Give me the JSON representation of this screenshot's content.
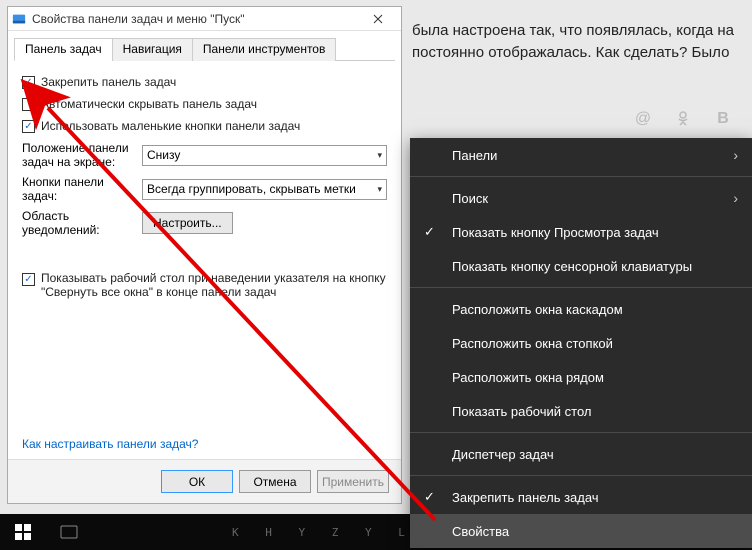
{
  "background_text": "была настроена так, что появлялась, когда на постоянно отображалась. Как сделать? Было",
  "social_icons": [
    "@",
    "ok",
    "B"
  ],
  "dialog": {
    "title": "Свойства панели задач и меню \"Пуск\"",
    "tabs": [
      "Панель задач",
      "Навигация",
      "Панели инструментов"
    ],
    "active_tab": 0,
    "chk_lock": "Закрепить панель задач",
    "chk_autohide": "Автоматически скрывать панель задач",
    "chk_small": "Использовать маленькие кнопки панели задач",
    "label_position": "Положение панели задач на экране:",
    "select_position": "Снизу",
    "label_buttons": "Кнопки панели задач:",
    "select_buttons": "Всегда группировать, скрывать метки",
    "label_notif": "Область уведомлений:",
    "btn_customize": "Настроить...",
    "chk_peek": "Показывать рабочий стол при наведении указателя на кнопку \"Свернуть все окна\" в конце панели задач",
    "link_help": "Как настраивать панели задач?",
    "btn_ok": "ОК",
    "btn_cancel": "Отмена",
    "btn_apply": "Применить"
  },
  "ctx": {
    "panels": "Панели",
    "search": "Поиск",
    "taskview": "Показать кнопку Просмотра задач",
    "touchkb": "Показать кнопку сенсорной клавиатуры",
    "cascade": "Расположить окна каскадом",
    "stacked": "Расположить окна стопкой",
    "sidebyside": "Расположить окна рядом",
    "showdesktop": "Показать рабочий стол",
    "taskmgr": "Диспетчер задач",
    "lock": "Закрепить панель задач",
    "props": "Свойства"
  },
  "taskbar_text": "K H Y Z Y L   S"
}
